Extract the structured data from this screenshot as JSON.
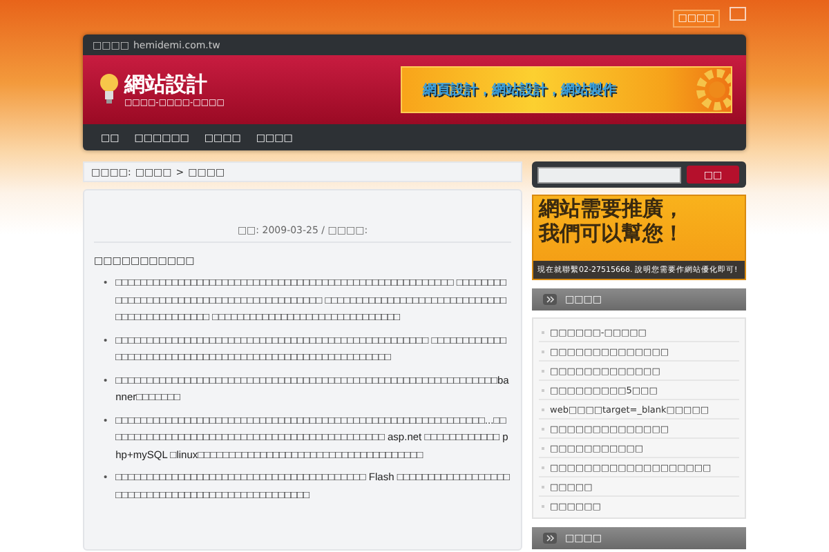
{
  "top_button": "□□□□",
  "header": {
    "site_label": "□□□□",
    "site_url": "hemidemi.com.tw",
    "logo_title": "網站設計",
    "logo_tagline": "□□□□-□□□□-□□□□",
    "banner_text": "網頁設計，網站設計，網站製作"
  },
  "nav": [
    {
      "label": "□□"
    },
    {
      "label": "□□□□□□"
    },
    {
      "label": "□□□□"
    },
    {
      "label": "□□□□"
    }
  ],
  "breadcrumb": {
    "prefix": "□□□□:",
    "items": [
      "□□□□",
      "□□□□"
    ],
    "separator": ">"
  },
  "article": {
    "meta": "□□: 2009-03-25 / □□□□:",
    "heading": "□□□□□□□□□□□",
    "marker": "•",
    "bullets": [
      "□□□□□□□□□□□□□□□□□□□□□□□□□□□□□□□□□□□□□□□□□□□□□□□□□□□□□□ □□□□□□□□□□□□□□□□□□□□□□□□□□□□□□□□□□□□□□□□□ □□□□□□□□□□□□□□□□□□□□□□□□□□□□□□□□□□□□□□□□□□□□ □□□□□□□□□□□□□□□□□□□□□□□□□□□□□□",
      "□□□□□□□□□□□□□□□□□□□□□□□□□□□□□□□□□□□□□□□□□□□□□□□□□□ □□□□□□□□□□□□□□□□□□□□□□□□□□□□□□□□□□□□□□□□□□□□□□□□□□□□□□□□",
      "□□□□□□□□□□□□□□□□□□□□□□□□□□□□□□□□□□□□□□□□□□□□□□□□□□□□□□□□□□□□□banner□□□□□□□",
      "□□□□□□□□□□□□□□□□□□□□□□□□□□□□□□□□□□□□□□□□□□□□□□□□□□□□□□□□□□□...□□□□□□□□□□□□□□□□□□□□□□□□□□□□□□□□□□□□□□□□□□□□□ asp.net □□□□□□□□□□□□ php+mySQL □linux□□□□□□□□□□□□□□□□□□□□□□□□□□□□□□□□□□□□",
      "□□□□□□□□□□□□□□□□□□□□□□□□□□□□□□□□□□□□□□□□ Flash □□□□□□□□□□□□□□□□□□□□□□□□□□□□□□□□□□□□□□□□□□□□□□□□□"
    ]
  },
  "sidebar": {
    "search": {
      "button": "□□"
    },
    "ad": {
      "headline_1": "網站需要推廣，",
      "headline_2": "我們可以幫您！",
      "footer": "現在就聯繫02-27515668. 說明您需要作網站優化即可!"
    },
    "widgets": [
      {
        "title": "□□□□",
        "items": [
          "□□□□□□-□□□□□",
          "□□□□□□□□□□□□□□",
          "□□□□□□□□□□□□□",
          "□□□□□□□□□5□□□",
          "web□□□□target=_blank□□□□□",
          "□□□□□□□□□□□□□□",
          "□□□□□□□□□□□",
          "□□□□□□□□□□□□□□□□□□□",
          "□□□□□",
          "□□□□□□"
        ]
      },
      {
        "title": "□□□□"
      }
    ]
  }
}
